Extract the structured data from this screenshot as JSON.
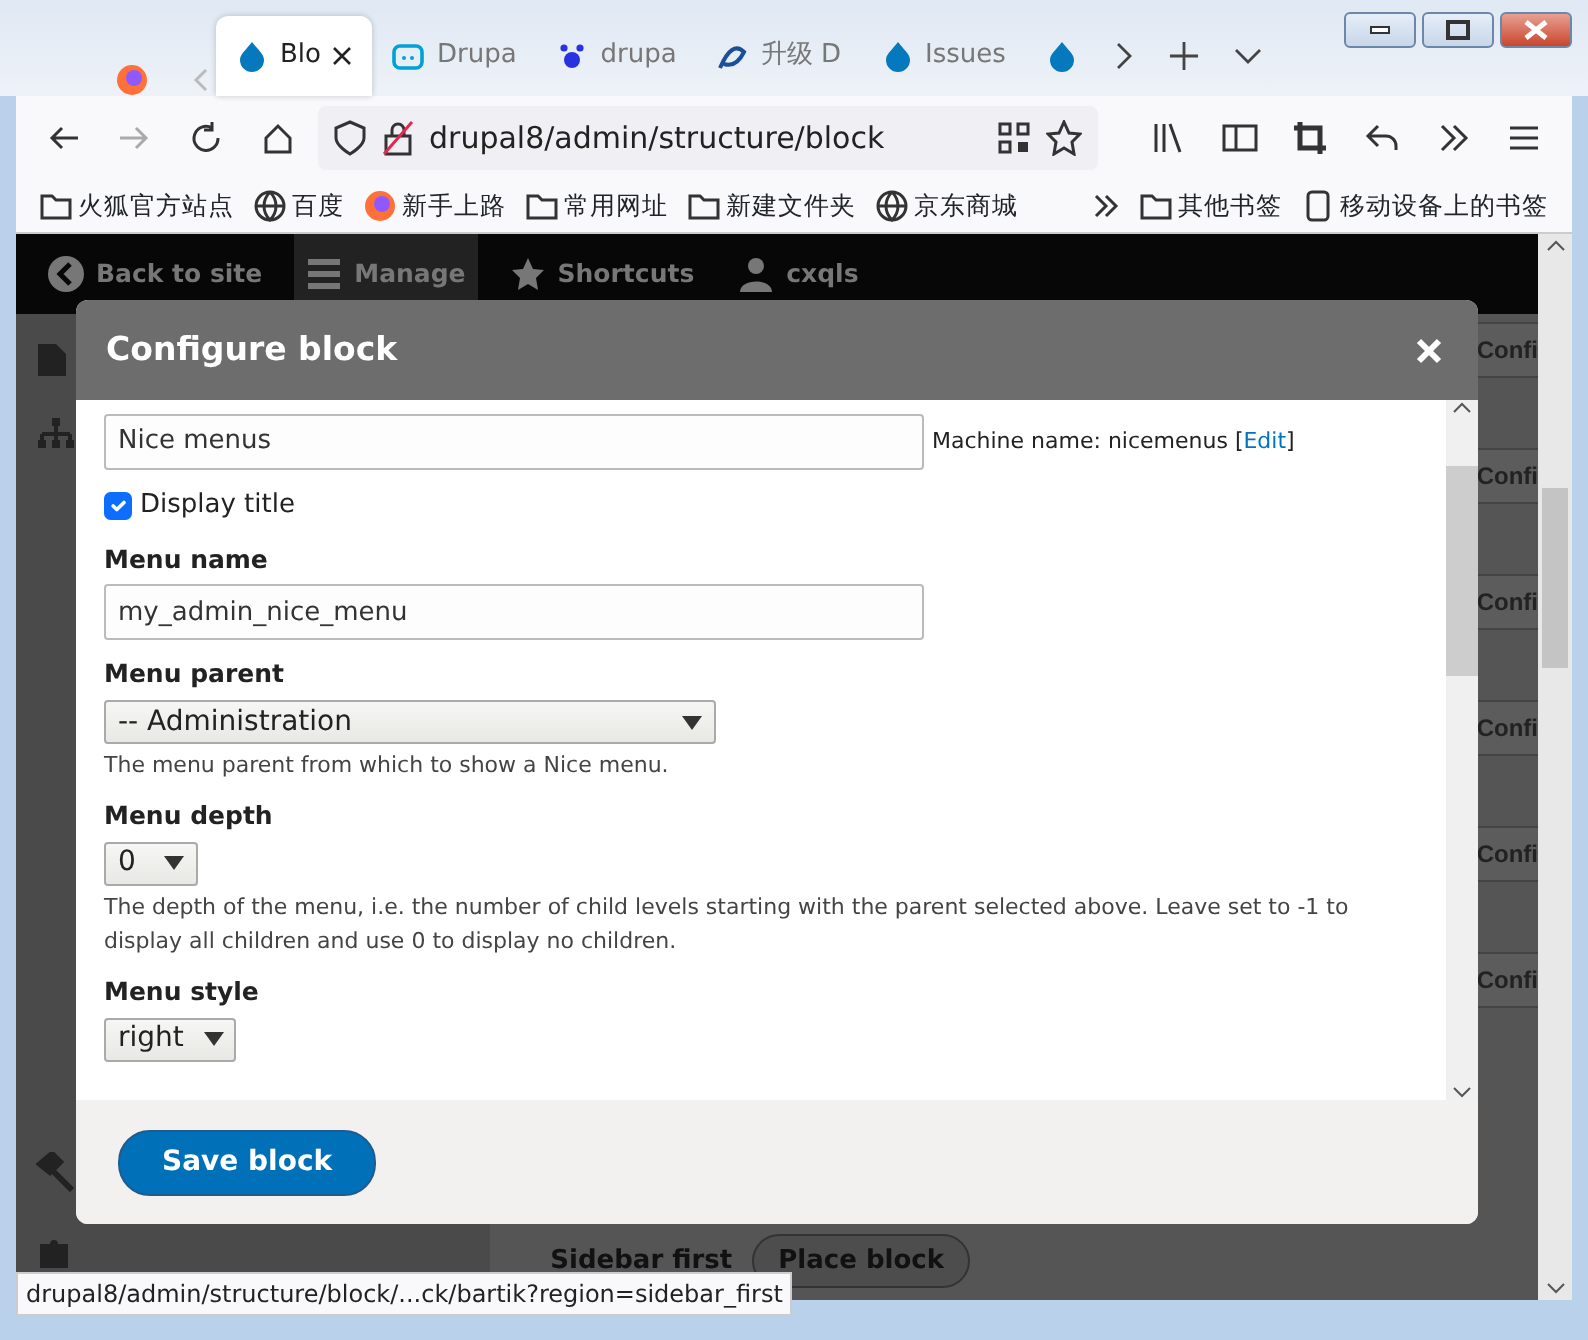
{
  "browser": {
    "tabs": [
      {
        "label": "Blo",
        "selected": true
      },
      {
        "label": "Drupa",
        "selected": false
      },
      {
        "label": "drupa",
        "selected": false
      },
      {
        "label": "升级 D",
        "selected": false
      },
      {
        "label": "Issues",
        "selected": false
      },
      {
        "selected": false
      }
    ],
    "address": "drupal8/admin/structure/block",
    "bookmarks": [
      {
        "label": "火狐官方站点",
        "kind": "folder"
      },
      {
        "label": "百度",
        "kind": "globe"
      },
      {
        "label": "新手上路",
        "kind": "firefox"
      },
      {
        "label": "常用网址",
        "kind": "folder"
      },
      {
        "label": "新建文件夹",
        "kind": "folder"
      },
      {
        "label": "京东商城",
        "kind": "globe"
      }
    ],
    "bookmarks_right": [
      {
        "label": "其他书签",
        "kind": "folder"
      },
      {
        "label": "移动设备上的书签",
        "kind": "device"
      }
    ]
  },
  "admin_toolbar": [
    "Back to site",
    "Manage",
    "Shortcuts",
    "cxqls"
  ],
  "background": {
    "row_actions": [
      "Confi",
      "Confi",
      "Confi",
      "Confi",
      "Confi",
      "Confi"
    ],
    "region": "Sidebar first",
    "place_button": "Place block"
  },
  "dialog": {
    "title": "Configure block",
    "title_field": {
      "value": "Nice menus"
    },
    "machine_name": {
      "label": "Machine name: nicemenus [",
      "link": "Edit",
      "suffix": "]"
    },
    "display_title": {
      "label": "Display title",
      "checked": true
    },
    "menu_name": {
      "label": "Menu name",
      "value": "my_admin_nice_menu"
    },
    "menu_parent": {
      "label": "Menu parent",
      "value": "-- Administration",
      "description": "The menu parent from which to show a Nice menu."
    },
    "menu_depth": {
      "label": "Menu depth",
      "value": "0",
      "description": "The depth of the menu, i.e. the number of child levels starting with the parent selected above. Leave set to -1 to display all children and use 0 to display no children."
    },
    "menu_style": {
      "label": "Menu style",
      "value": "right"
    },
    "save_button": "Save block"
  },
  "status_url": "drupal8/admin/structure/block/...ck/bartik?region=sidebar_first"
}
